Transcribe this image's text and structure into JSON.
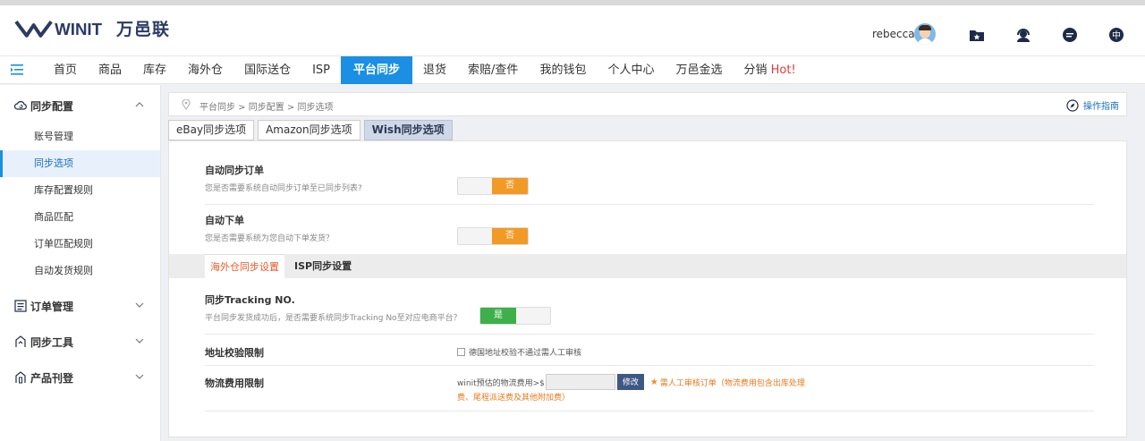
{
  "header": {
    "logo_letters": "WINIT",
    "logo_cn": "万邑联",
    "user_name": "rebecca",
    "icons": [
      "folder-star-icon",
      "support-agent-icon",
      "chat-icon",
      "language-icon"
    ],
    "lang_label": "中"
  },
  "nav": {
    "items": [
      "首页",
      "商品",
      "库存",
      "海外仓",
      "国际送仓",
      "ISP",
      "平台同步",
      "退货",
      "索赔/查件",
      "我的钱包",
      "个人中心",
      "万邑金选",
      "分销"
    ],
    "hot_label": "Hot!",
    "active": "平台同步"
  },
  "sidebar": {
    "groups": [
      {
        "label": "同步配置",
        "expanded": true,
        "items": [
          "账号管理",
          "同步选项",
          "库存配置规则",
          "商品匹配",
          "订单匹配规则",
          "自动发货规则"
        ]
      },
      {
        "label": "订单管理",
        "expanded": false
      },
      {
        "label": "同步工具",
        "expanded": false
      },
      {
        "label": "产品刊登",
        "expanded": false
      }
    ],
    "active_item": "同步选项"
  },
  "breadcrumb": {
    "text": "平台同步 > 同步配置 > 同步选项",
    "guide_label": "操作指南"
  },
  "subtabs": [
    "eBay同步选项",
    "Amazon同步选项",
    "Wish同步选项"
  ],
  "active_subtab": "Wish同步选项",
  "settings": {
    "auto_sync": {
      "title": "自动同步订单",
      "desc": "您是否需要系统自动同步订单至已同步列表?",
      "value": "否"
    },
    "auto_order": {
      "title": "自动下单",
      "desc": "您是否需要系统为您自动下单发货？",
      "value": "否"
    },
    "inner_tabs": [
      "海外仓同步设置",
      "ISP同步设置"
    ],
    "tracking": {
      "title": "同步Tracking NO.",
      "desc": "平台同步发货成功后，是否需要系统同步Tracking No至对应电商平台？",
      "value": "是"
    },
    "address": {
      "title": "地址校验限制",
      "checkbox_label": "德国地址校验不通过需人工审核"
    },
    "fee": {
      "title": "物流费用限制",
      "label": "winit预估的物流费用>$",
      "input_value": "",
      "button": "修改",
      "note_line1": "需人工审核订单（物流费用包含出库处理",
      "note_line2": "费、尾程派送费及其他附加费）"
    }
  },
  "colors": {
    "primary": "#1a8fe3",
    "toggle_off": "#f29a26",
    "toggle_on": "#3db04a",
    "accent_orange": "#e87a1e"
  }
}
